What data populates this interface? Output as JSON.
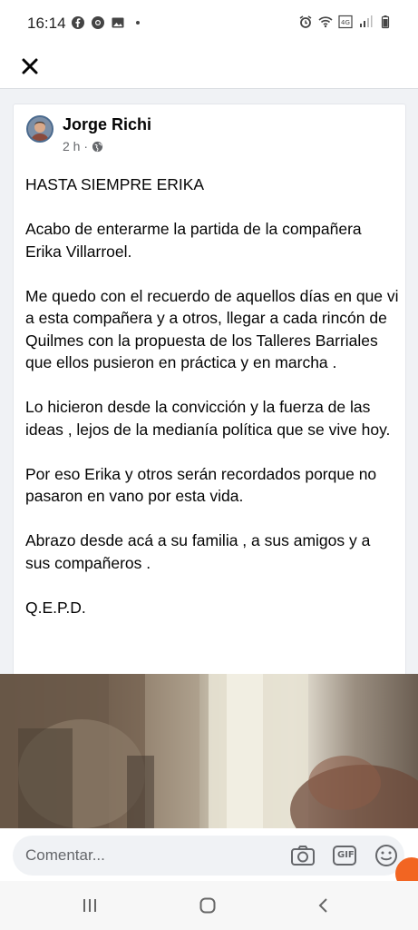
{
  "status_bar": {
    "time": "16:14",
    "left_icons": [
      "facebook-icon",
      "chrome-icon",
      "image-icon",
      "dot-icon"
    ],
    "right_icons": [
      "alarm-icon",
      "wifi-icon",
      "4g-icon",
      "signal-icon",
      "battery-icon"
    ]
  },
  "top_bar": {
    "close_icon": "close-icon"
  },
  "post": {
    "author": "Jorge Richi",
    "time_ago": "2 h ·",
    "privacy_icon": "globe-icon",
    "paragraphs": [
      "HASTA SIEMPRE ERIKA",
      "Acabo de enterarme la partida de la compañera Erika Villarroel.",
      "Me quedo con el recuerdo de aquellos días en que vi a esta compañera y a otros, llegar a cada rincón de Quilmes con la propuesta de los Talleres Barriales que ellos pusieron en práctica y en marcha .",
      "Lo hicieron desde la convicción y la fuerza de las ideas , lejos de la medianía política que se vive hoy.",
      "Por eso Erika y otros serán recordados porque no pasaron en vano por esta vida.",
      "Abrazo desde acá a su familia , a sus amigos y a sus compañeros .",
      "Q.E.P.D."
    ]
  },
  "comment_bar": {
    "placeholder": "Comentar...",
    "camera_icon": "camera-icon",
    "gif_label": "GIF",
    "emoji_icon": "emoji-icon"
  },
  "nav_bar": {
    "recents_icon": "recents-icon",
    "home_icon": "home-icon",
    "back_icon": "back-icon"
  },
  "colors": {
    "accent_orange": "#f26522",
    "link_text": "#050505",
    "meta_grey": "#65676b"
  }
}
